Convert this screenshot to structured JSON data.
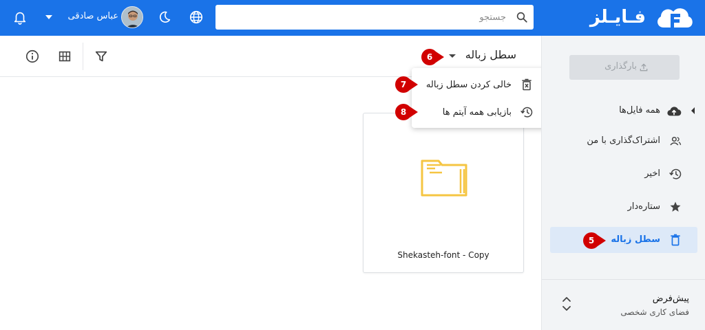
{
  "header": {
    "brand": "فـایـلز",
    "search_placeholder": "جستجو",
    "user_name": "عباس صادقی"
  },
  "toolbar": {
    "breadcrumb": "سطل زباله"
  },
  "menu": {
    "items": [
      {
        "label": "خالی کردن سطل زباله",
        "icon": "delete-forever-icon"
      },
      {
        "label": "بازیابی همه آیتم ها",
        "icon": "restore-icon"
      }
    ]
  },
  "sidebar": {
    "upload_label": "بارگذاری",
    "items": [
      {
        "label": "همه فایل‌ها",
        "icon": "cloud-upload-icon"
      },
      {
        "label": "اشتراک‌گذاری با من",
        "icon": "people-icon"
      },
      {
        "label": "اخیر",
        "icon": "history-icon"
      },
      {
        "label": "ستاره‌دار",
        "icon": "star-icon"
      },
      {
        "label": "سطل زباله",
        "icon": "trash-icon",
        "active": true
      }
    ],
    "workspace": {
      "name": "پیش‌فرض",
      "subtitle": "فضای کاری شخصی"
    }
  },
  "files": [
    {
      "name": "Shekasteh-font - Copy",
      "type": "folder"
    }
  ],
  "markers": [
    "5",
    "6",
    "7",
    "8"
  ],
  "colors": {
    "primary": "#1a73e8",
    "marker": "#d10000",
    "folder": "#f5c542",
    "sidebar_bg": "#f2f4f6"
  }
}
